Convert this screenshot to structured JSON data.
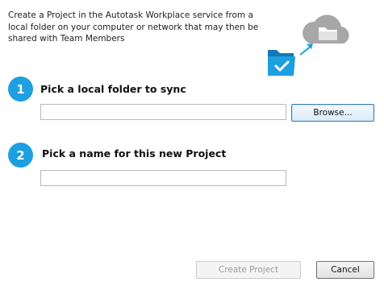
{
  "intro_text": "Create a Project in the Autotask Workplace service from a local folder on your computer or network that may then be shared with Team Members",
  "illustration": {
    "icons": [
      "cloud-folder-icon",
      "arrow-icon",
      "local-folder-check-icon"
    ],
    "colors": {
      "cloud": "#a7a7a7",
      "folder": "#1e9fe0",
      "arrow": "#1e9fe0"
    }
  },
  "step1": {
    "number": "1",
    "title": "Pick a local folder to sync",
    "folder_value": "",
    "browse_label": "Browse..."
  },
  "step2": {
    "number": "2",
    "title": "Pick a name for this new Project",
    "name_value": ""
  },
  "footer": {
    "create_label": "Create Project",
    "cancel_label": "Cancel"
  },
  "colors": {
    "accent": "#1e9fe0",
    "disabled_text": "#9a9a9a"
  }
}
